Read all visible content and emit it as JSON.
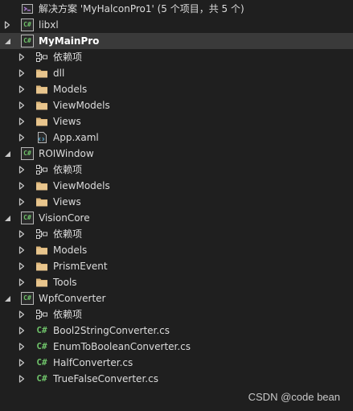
{
  "solution_title": "解决方案 'MyHalconPro1' (5 个项目，共 5 个)",
  "watermark": "CSDN @code bean",
  "colors": {
    "background": "#1f1f1f",
    "selected_row": "#3a3a3a",
    "text": "#dcdcdc",
    "folder": "#dcb67a",
    "csharp": "#6fc36a",
    "xaml": "#519aba"
  },
  "tree": [
    {
      "label": "解决方案 'MyHalconPro1' (5 个项目，共 5 个)",
      "icon": "solution-icon",
      "level": 0,
      "arrow": "none"
    },
    {
      "label": "libxl",
      "icon": "csharp-project-icon",
      "level": 0,
      "arrow": "collapsed"
    },
    {
      "label": "MyMainPro",
      "icon": "csharp-project-icon",
      "level": 0,
      "arrow": "expanded",
      "selected": true,
      "bold": true
    },
    {
      "label": "依赖项",
      "icon": "dependencies-icon",
      "level": 1,
      "arrow": "collapsed"
    },
    {
      "label": "dll",
      "icon": "folder-icon",
      "level": 1,
      "arrow": "collapsed"
    },
    {
      "label": "Models",
      "icon": "folder-icon",
      "level": 1,
      "arrow": "collapsed"
    },
    {
      "label": "ViewModels",
      "icon": "folder-icon",
      "level": 1,
      "arrow": "collapsed"
    },
    {
      "label": "Views",
      "icon": "folder-icon",
      "level": 1,
      "arrow": "collapsed"
    },
    {
      "label": "App.xaml",
      "icon": "xaml-file-icon",
      "level": 1,
      "arrow": "collapsed"
    },
    {
      "label": "ROIWindow",
      "icon": "csharp-project-icon",
      "level": 0,
      "arrow": "expanded"
    },
    {
      "label": "依赖项",
      "icon": "dependencies-icon",
      "level": 1,
      "arrow": "collapsed"
    },
    {
      "label": "ViewModels",
      "icon": "folder-icon",
      "level": 1,
      "arrow": "collapsed"
    },
    {
      "label": "Views",
      "icon": "folder-icon",
      "level": 1,
      "arrow": "collapsed"
    },
    {
      "label": "VisionCore",
      "icon": "csharp-project-icon",
      "level": 0,
      "arrow": "expanded"
    },
    {
      "label": "依赖项",
      "icon": "dependencies-icon",
      "level": 1,
      "arrow": "collapsed"
    },
    {
      "label": "Models",
      "icon": "folder-icon",
      "level": 1,
      "arrow": "collapsed"
    },
    {
      "label": "PrismEvent",
      "icon": "folder-icon",
      "level": 1,
      "arrow": "collapsed"
    },
    {
      "label": "Tools",
      "icon": "folder-icon",
      "level": 1,
      "arrow": "collapsed"
    },
    {
      "label": "WpfConverter",
      "icon": "csharp-project-icon",
      "level": 0,
      "arrow": "expanded"
    },
    {
      "label": "依赖项",
      "icon": "dependencies-icon",
      "level": 1,
      "arrow": "collapsed"
    },
    {
      "label": "Bool2StringConverter.cs",
      "icon": "csharp-file-icon",
      "level": 1,
      "arrow": "collapsed"
    },
    {
      "label": "EnumToBooleanConverter.cs",
      "icon": "csharp-file-icon",
      "level": 1,
      "arrow": "collapsed"
    },
    {
      "label": "HalfConverter.cs",
      "icon": "csharp-file-icon",
      "level": 1,
      "arrow": "collapsed"
    },
    {
      "label": "TrueFalseConverter.cs",
      "icon": "csharp-file-icon",
      "level": 1,
      "arrow": "collapsed"
    }
  ]
}
